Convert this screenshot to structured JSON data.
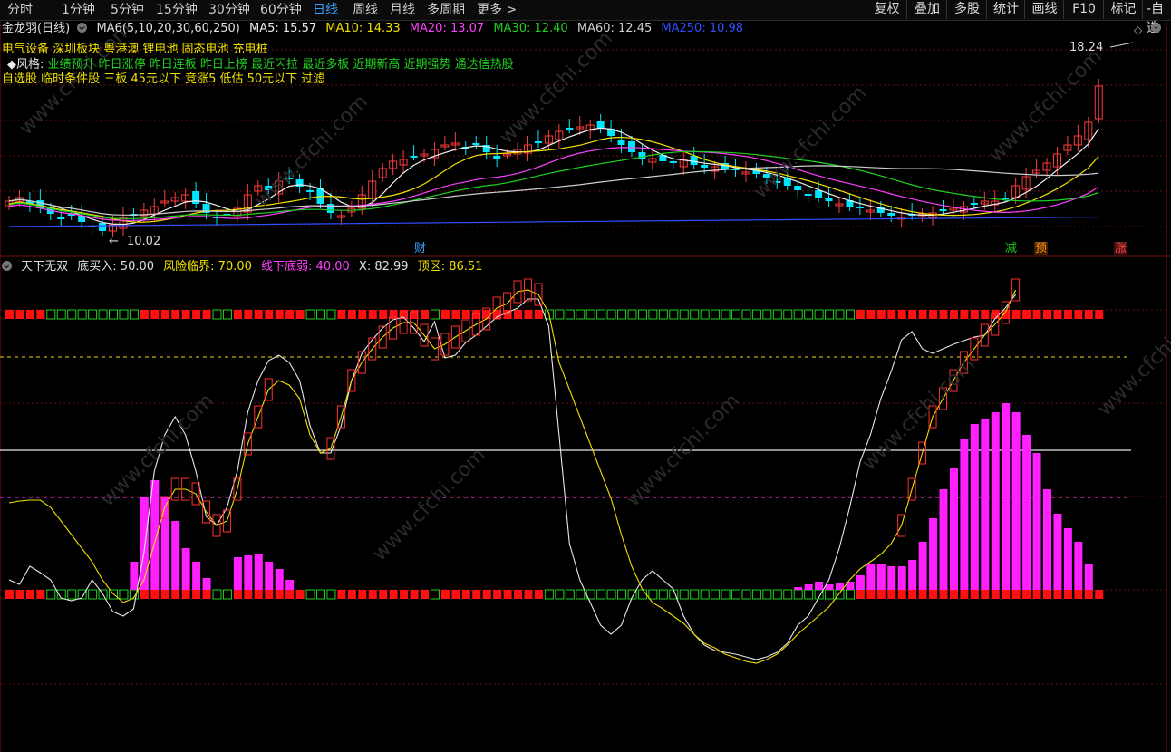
{
  "topbar": {
    "periods": [
      "分时",
      "1分钟",
      "5分钟",
      "15分钟",
      "30分钟",
      "60分钟",
      "日线",
      "周线",
      "月线",
      "多周期",
      "更多 >"
    ],
    "active_period": "日线",
    "right_buttons": [
      "复权",
      "叠加",
      "多股",
      "统计",
      "画线",
      "F10",
      "标记",
      "-自选"
    ]
  },
  "stock": {
    "title": "金龙羽(日线)",
    "ma_label": "MA6(5,10,20,30,60,250)",
    "ma": [
      {
        "label": "MA5: 15.57",
        "color": "#f0f0f0"
      },
      {
        "label": "MA10: 14.33",
        "color": "#f2e000"
      },
      {
        "label": "MA20: 13.07",
        "color": "#ff40ff"
      },
      {
        "label": "MA30: 12.40",
        "color": "#20d020"
      },
      {
        "label": "MA60: 12.45",
        "color": "#d0d0d0"
      },
      {
        "label": "MA250: 10.98",
        "color": "#3050ff"
      }
    ],
    "high_label": "18.24",
    "low_label": "10.02",
    "fin_tag": "财",
    "tags": [
      {
        "text": "减",
        "color": "#20c020"
      },
      {
        "text": "预",
        "color": "#ff9020"
      },
      {
        "text": "涨",
        "color": "#ff4040"
      }
    ]
  },
  "sectors": {
    "line1": "电气设备 深圳板块 粤港澳 锂电池 固态电池 充电桩",
    "style_label": "◆风格:",
    "line2": "业绩预升 昨日涨停 昨日连板 昨日上榜 最近闪拉 最近多板 近期新高 近期强势 通达信热股",
    "line3": "自选股 临时条件股 三板 45元以下 竞涨5 低估 50元以下 过滤"
  },
  "indicator": {
    "name": "天下无双",
    "values": [
      {
        "label": "底买入: 50.00",
        "color": "#e0e0e0"
      },
      {
        "label": "风险临界: 70.00",
        "color": "#f2e000"
      },
      {
        "label": "线下底弱: 40.00",
        "color": "#ff40ff"
      },
      {
        "label": "X: 82.99",
        "color": "#e0e0e0"
      },
      {
        "label": "顶区: 86.51",
        "color": "#f2e000"
      }
    ]
  },
  "watermark": "www.cfchi.com",
  "colors": {
    "up": "#ff3b3b",
    "down": "#00e5ff",
    "bg": "#000000",
    "grid": "#7a1010"
  }
}
